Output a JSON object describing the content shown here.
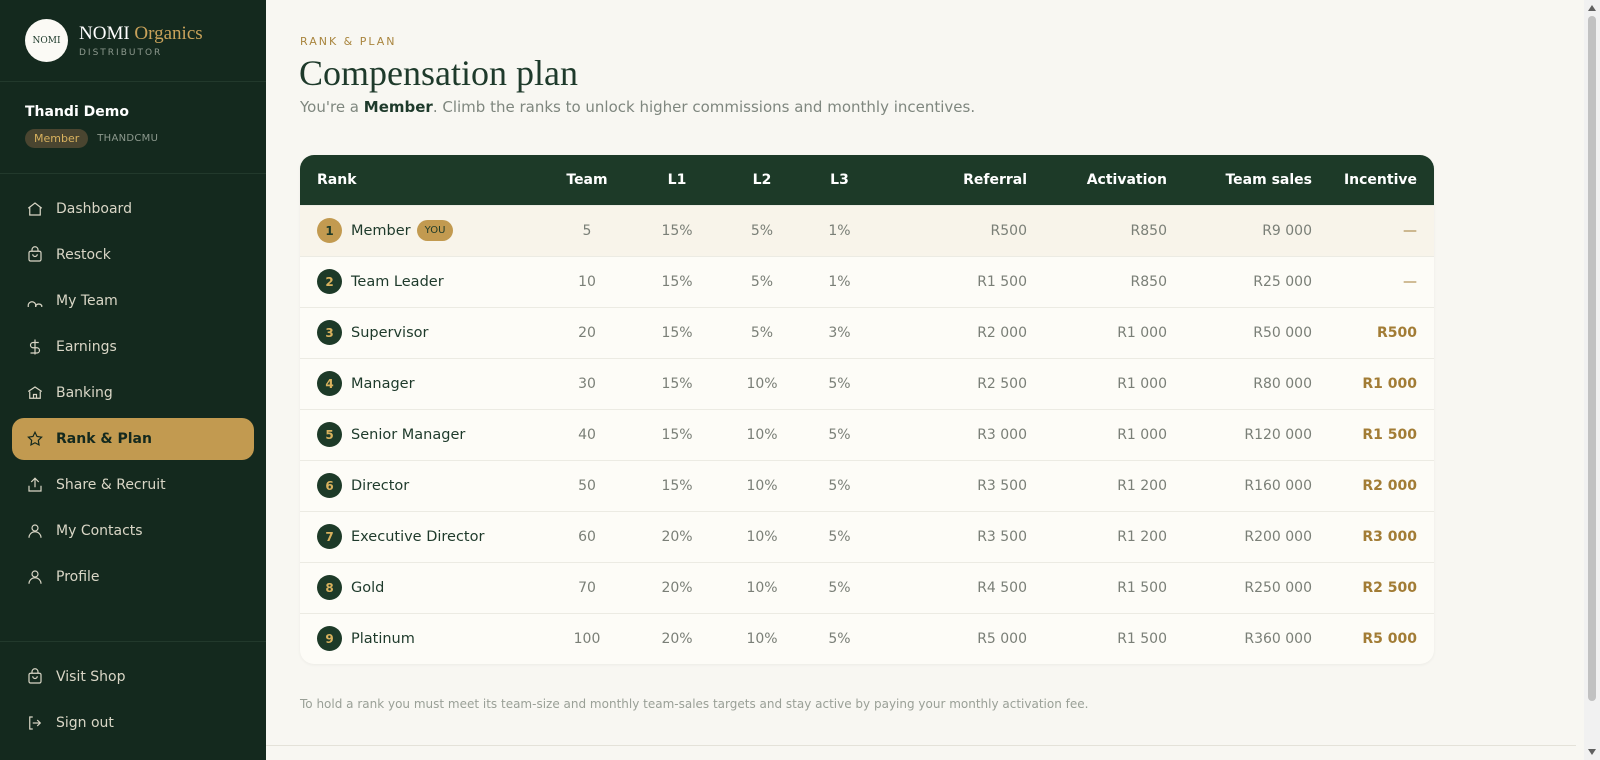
{
  "brand": {
    "logo_text": "NOMI",
    "name": "NOMI",
    "name_accent": "Organics",
    "subtitle": "DISTRIBUTOR"
  },
  "user": {
    "name": "Thandi Demo",
    "rank_badge": "Member",
    "code": "THANDCMU"
  },
  "nav": {
    "items": [
      {
        "label": "Dashboard",
        "icon": "home-icon"
      },
      {
        "label": "Restock",
        "icon": "shopping-bag-icon"
      },
      {
        "label": "My Team",
        "icon": "users-icon"
      },
      {
        "label": "Earnings",
        "icon": "dollar-icon"
      },
      {
        "label": "Banking",
        "icon": "bank-icon"
      },
      {
        "label": "Rank & Plan",
        "icon": "star-icon",
        "active": true
      },
      {
        "label": "Share & Recruit",
        "icon": "share-icon"
      },
      {
        "label": "My Contacts",
        "icon": "user-icon"
      },
      {
        "label": "Profile",
        "icon": "user-icon"
      }
    ],
    "bottom": [
      {
        "label": "Visit Shop",
        "icon": "shopping-bag-icon"
      },
      {
        "label": "Sign out",
        "icon": "sign-out-icon"
      }
    ]
  },
  "page": {
    "eyebrow": "RANK & PLAN",
    "title": "Compensation plan",
    "subtitle_prefix": "You're a ",
    "subtitle_rank": "Member",
    "subtitle_suffix": ". Climb the ranks to unlock higher commissions and monthly incentives.",
    "footnote": "To hold a rank you must meet its team-size and monthly team-sales targets and stay active by paying your monthly activation fee."
  },
  "table": {
    "headers": [
      "Rank",
      "Team",
      "L1",
      "L2",
      "L3",
      "Referral",
      "Activation",
      "Team sales",
      "Incentive"
    ],
    "you_badge": "YOU",
    "rows": [
      {
        "num": "1",
        "rank": "Member",
        "team": "5",
        "l1": "15%",
        "l2": "5%",
        "l3": "1%",
        "referral": "R500",
        "activation": "R850",
        "team_sales": "R9 000",
        "incentive": "—",
        "current": true
      },
      {
        "num": "2",
        "rank": "Team Leader",
        "team": "10",
        "l1": "15%",
        "l2": "5%",
        "l3": "1%",
        "referral": "R1 500",
        "activation": "R850",
        "team_sales": "R25 000",
        "incentive": "—"
      },
      {
        "num": "3",
        "rank": "Supervisor",
        "team": "20",
        "l1": "15%",
        "l2": "5%",
        "l3": "3%",
        "referral": "R2 000",
        "activation": "R1 000",
        "team_sales": "R50 000",
        "incentive": "R500"
      },
      {
        "num": "4",
        "rank": "Manager",
        "team": "30",
        "l1": "15%",
        "l2": "10%",
        "l3": "5%",
        "referral": "R2 500",
        "activation": "R1 000",
        "team_sales": "R80 000",
        "incentive": "R1 000"
      },
      {
        "num": "5",
        "rank": "Senior Manager",
        "team": "40",
        "l1": "15%",
        "l2": "10%",
        "l3": "5%",
        "referral": "R3 000",
        "activation": "R1 000",
        "team_sales": "R120 000",
        "incentive": "R1 500"
      },
      {
        "num": "6",
        "rank": "Director",
        "team": "50",
        "l1": "15%",
        "l2": "10%",
        "l3": "5%",
        "referral": "R3 500",
        "activation": "R1 200",
        "team_sales": "R160 000",
        "incentive": "R2 000"
      },
      {
        "num": "7",
        "rank": "Executive Director",
        "team": "60",
        "l1": "20%",
        "l2": "10%",
        "l3": "5%",
        "referral": "R3 500",
        "activation": "R1 200",
        "team_sales": "R200 000",
        "incentive": "R3 000"
      },
      {
        "num": "8",
        "rank": "Gold",
        "team": "70",
        "l1": "20%",
        "l2": "10%",
        "l3": "5%",
        "referral": "R4 500",
        "activation": "R1 500",
        "team_sales": "R250 000",
        "incentive": "R2 500"
      },
      {
        "num": "9",
        "rank": "Platinum",
        "team": "100",
        "l1": "20%",
        "l2": "10%",
        "l3": "5%",
        "referral": "R5 000",
        "activation": "R1 500",
        "team_sales": "R360 000",
        "incentive": "R5 000"
      }
    ]
  },
  "colors": {
    "sidebar_bg": "#14291e",
    "accent_gold": "#c29a50",
    "header_green": "#1d3a28",
    "page_bg": "#f8f7f2"
  }
}
